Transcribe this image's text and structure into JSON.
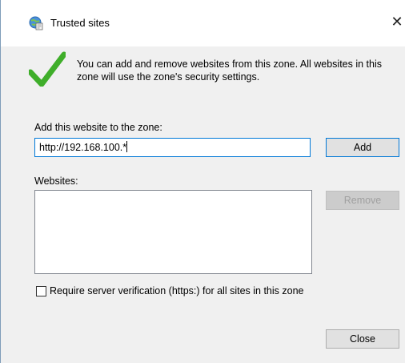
{
  "window": {
    "title": "Trusted sites",
    "close_glyph": "✕"
  },
  "info": {
    "icon": "checkmark-icon",
    "text": "You can add and remove websites from this zone. All websites in this zone will use the zone's security settings."
  },
  "add_site": {
    "label": "Add this website to the zone:",
    "value": "http://192.168.100.*",
    "button": "Add"
  },
  "websites": {
    "label": "Websites:",
    "items": [],
    "remove_button": "Remove"
  },
  "require_verification": {
    "label": "Require server verification (https:) for all sites in this zone",
    "checked": false
  },
  "footer": {
    "close_button": "Close"
  },
  "colors": {
    "accent": "#0078d7",
    "check_green": "#3fae2a"
  }
}
